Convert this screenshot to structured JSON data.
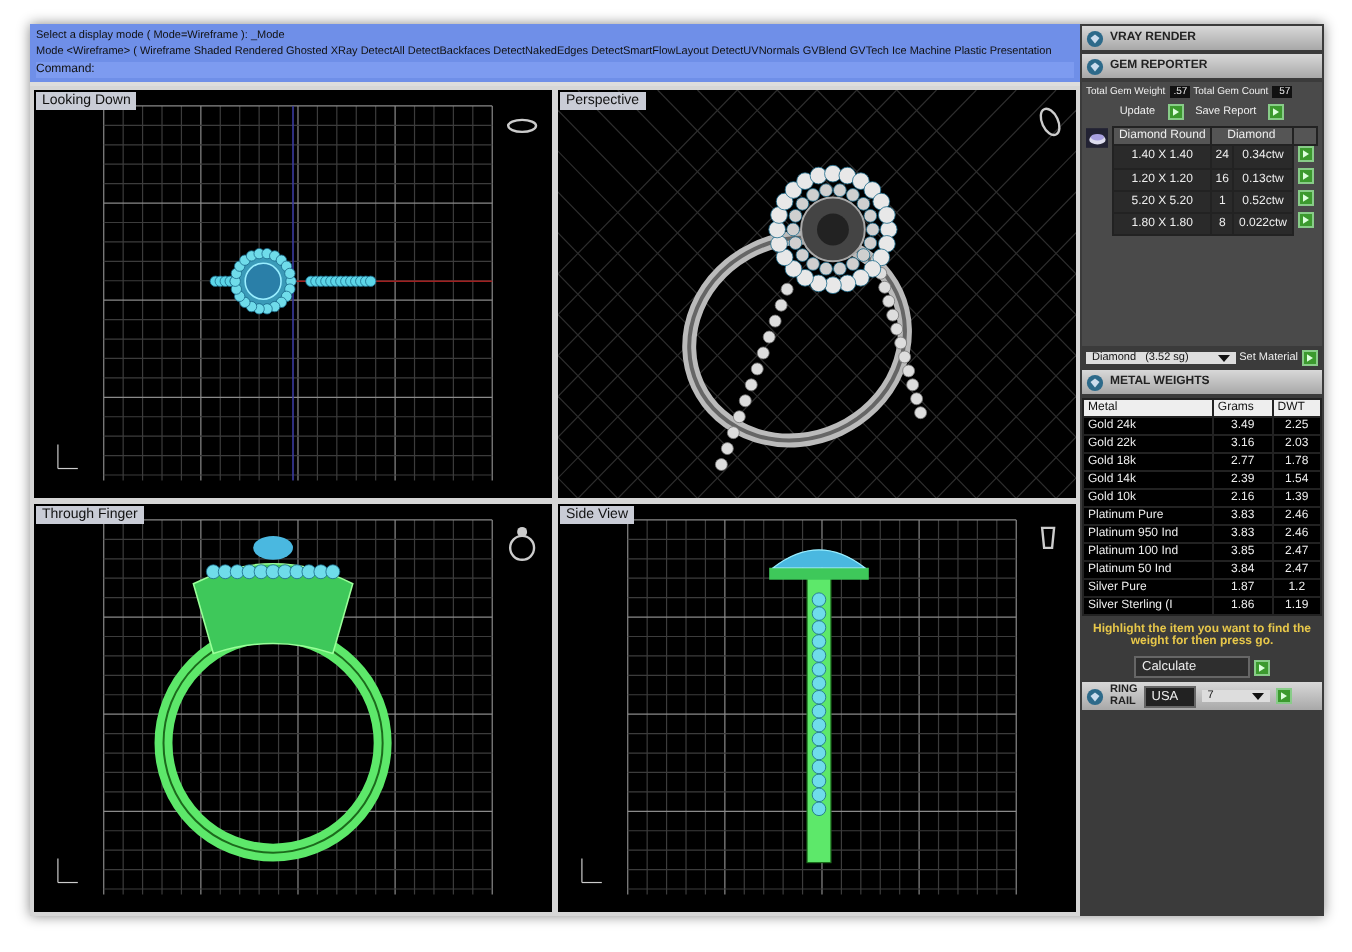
{
  "command_area": {
    "lines": [
      "Select a display mode ( Mode=Wireframe ): _Mode",
      "Mode <Wireframe> ( Wireframe Shaded Rendered Ghosted XRay DetectAll DetectBackfaces DetectNakedEdges DetectSmartFlowLayout DetectUVNormals GVBlend GVTech Ice Machine Plastic Presentation"
    ],
    "command_label": "Command:"
  },
  "viewports": [
    {
      "label": "Looking Down",
      "kind": "top"
    },
    {
      "label": "Perspective",
      "kind": "perspective"
    },
    {
      "label": "Through Finger",
      "kind": "front"
    },
    {
      "label": "Side View",
      "kind": "side"
    }
  ],
  "panel": {
    "headers": [
      "VRAY RENDER",
      "GEM REPORTER"
    ],
    "gem_reporter": {
      "weight_label": "Total Gem Weight",
      "weight_value": ".57",
      "count_label": "Total Gem Count",
      "count_value": "57",
      "update_button": "Update",
      "save_button": "Save Report",
      "columns": [
        "Diamond Round",
        "Diamond"
      ],
      "rows": [
        {
          "size": "1.40 X 1.40",
          "count": "24",
          "weight": "0.34ctw"
        },
        {
          "size": "1.20 X 1.20",
          "count": "16",
          "weight": "0.13ctw"
        },
        {
          "size": "5.20 X 5.20",
          "count": "1",
          "weight": "0.52ctw"
        },
        {
          "size": "1.80 X 1.80",
          "count": "8",
          "weight": "0.022ctw"
        }
      ]
    },
    "material": {
      "value": "Diamond   (3.52 sg)",
      "button": "Set Material"
    },
    "metal_weights": {
      "title": "METAL WEIGHTS",
      "columns": [
        "Metal",
        "Grams",
        "DWT"
      ],
      "rows": [
        [
          "Gold 24k",
          "3.49",
          "2.25"
        ],
        [
          "Gold 22k",
          "3.16",
          "2.03"
        ],
        [
          "Gold 18k",
          "2.77",
          "1.78"
        ],
        [
          "Gold 14k",
          "2.39",
          "1.54"
        ],
        [
          "Gold 10k",
          "2.16",
          "1.39"
        ],
        [
          "Platinum Pure",
          "3.83",
          "2.46"
        ],
        [
          "Platinum 950 Ind",
          "3.83",
          "2.46"
        ],
        [
          "Platinum 100 Ind",
          "3.85",
          "2.47"
        ],
        [
          "Platinum 50 Ind",
          "3.84",
          "2.47"
        ],
        [
          "Silver Pure",
          "1.87",
          "1.2"
        ],
        [
          "Silver Sterling (I",
          "1.86",
          "1.19"
        ]
      ],
      "hint": "Highlight the item you want to find the weight for then press go.",
      "calculate_label": "Calculate"
    },
    "ring": {
      "label_1": "RING",
      "label_2": "RAIL",
      "country": "USA",
      "size": "7"
    }
  }
}
